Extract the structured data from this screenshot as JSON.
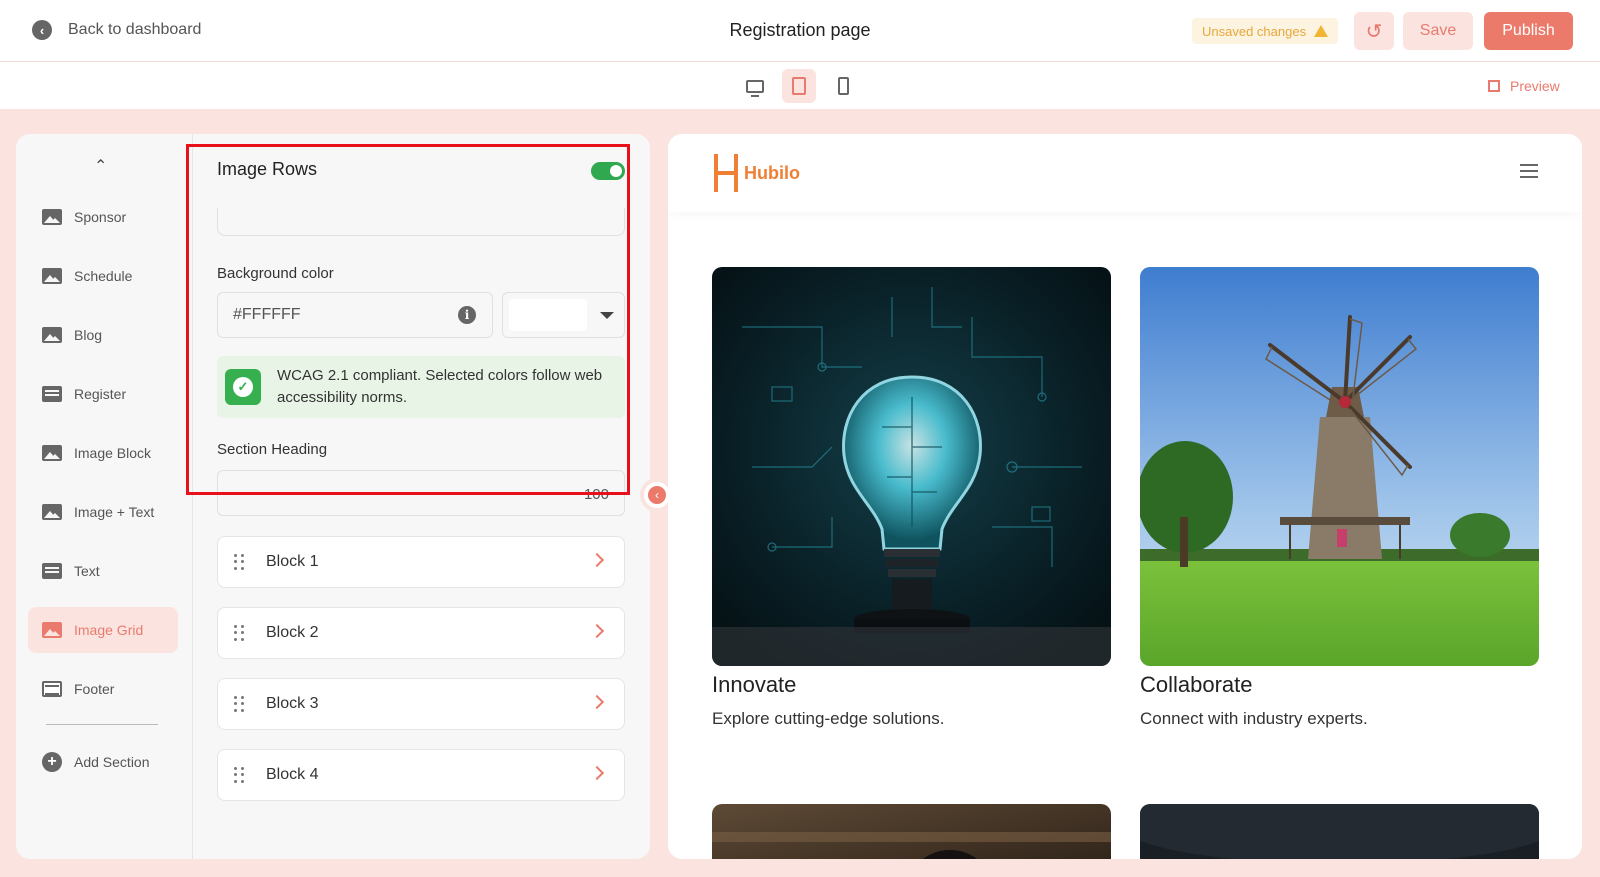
{
  "header": {
    "back_label": "Back to dashboard",
    "title": "Registration page",
    "unsaved": "Unsaved changes",
    "save": "Save",
    "publish": "Publish"
  },
  "devices": {
    "icons": [
      "desktop-icon",
      "tablet-icon",
      "mobile-icon"
    ],
    "active": "tablet",
    "preview_label": "Preview"
  },
  "sidebar": {
    "items": [
      {
        "label": "Sponsor",
        "icon": "image-icon"
      },
      {
        "label": "Schedule",
        "icon": "image-icon"
      },
      {
        "label": "Blog",
        "icon": "image-icon"
      },
      {
        "label": "Register",
        "icon": "form-icon"
      },
      {
        "label": "Image Block",
        "icon": "image-icon"
      },
      {
        "label": "Image + Text",
        "icon": "image-icon"
      },
      {
        "label": "Text",
        "icon": "text-icon"
      },
      {
        "label": "Image Grid",
        "icon": "image-icon"
      },
      {
        "label": "Footer",
        "icon": "footer-icon"
      }
    ],
    "active": "Image Grid",
    "add_section": "Add Section"
  },
  "panel": {
    "title": "Image Rows",
    "toggle_on": true,
    "bg_label": "Background color",
    "bg_value": "#FFFFFF",
    "wcag": "WCAG 2.1 compliant. Selected colors follow web accessibility norms.",
    "heading_label": "Section Heading",
    "heading_counter": "100",
    "blocks": [
      "Block 1",
      "Block 2",
      "Block 3",
      "Block 4"
    ]
  },
  "preview": {
    "brand": "Hubilo",
    "cards": [
      {
        "title": "Innovate",
        "desc": "Explore cutting-edge solutions."
      },
      {
        "title": "Collaborate",
        "desc": "Connect with industry experts."
      }
    ]
  },
  "colors": {
    "accent": "#EC7A6B",
    "brand": "#EF7F34",
    "success": "#36B04F",
    "warning": "#F0B532"
  }
}
